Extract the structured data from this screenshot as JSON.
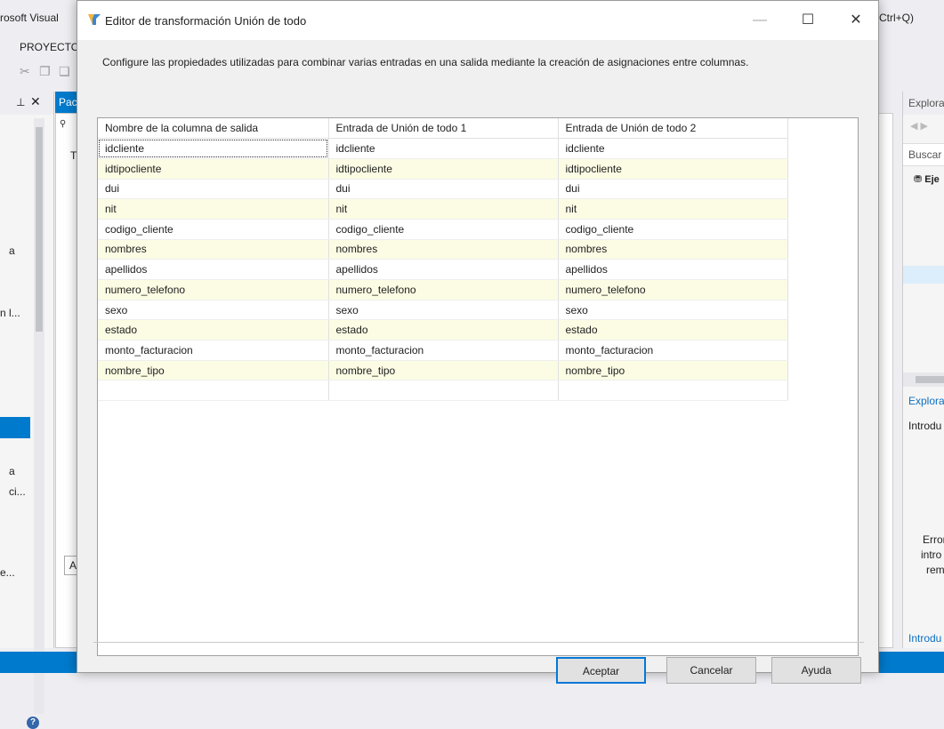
{
  "vs": {
    "title_fragment": "rosoft Visual",
    "search_hint": "(Ctrl+Q)",
    "menu_fragment": "PROYECTO",
    "doc_tab": "Pac",
    "doc_sub": "T",
    "lower_tab": "A",
    "left_labels": [
      "a",
      "n l...",
      "a",
      "ci...",
      "e..."
    ],
    "right": {
      "header": "Explora",
      "search": "Buscar",
      "tree_bold": "Eje",
      "explorer2": "Explora",
      "intro": "Introdu",
      "err_lines": [
        "Error",
        "intro",
        "rem"
      ],
      "intro_link": "Introdu"
    }
  },
  "dialog": {
    "title": "Editor de transformación Unión de todo",
    "description": "Configure las propiedades utilizadas para combinar varias entradas en una salida mediante la creación de asignaciones entre columnas.",
    "columns": [
      "Nombre de la columna de salida",
      "Entrada de Unión de todo 1",
      "Entrada de Unión de todo 2"
    ],
    "rows": [
      [
        "idcliente",
        "idcliente",
        "idcliente"
      ],
      [
        "idtipocliente",
        "idtipocliente",
        "idtipocliente"
      ],
      [
        "dui",
        "dui",
        "dui"
      ],
      [
        "nit",
        "nit",
        "nit"
      ],
      [
        "codigo_cliente",
        "codigo_cliente",
        "codigo_cliente"
      ],
      [
        "nombres",
        "nombres",
        "nombres"
      ],
      [
        "apellidos",
        "apellidos",
        "apellidos"
      ],
      [
        "numero_telefono",
        "numero_telefono",
        "numero_telefono"
      ],
      [
        "sexo",
        "sexo",
        "sexo"
      ],
      [
        "estado",
        "estado",
        "estado"
      ],
      [
        "monto_facturacion",
        "monto_facturacion",
        "monto_facturacion"
      ],
      [
        "nombre_tipo",
        "nombre_tipo",
        "nombre_tipo"
      ]
    ],
    "buttons": {
      "ok": "Aceptar",
      "cancel": "Cancelar",
      "help": "Ayuda"
    }
  },
  "colors": {
    "accent": "#007acc",
    "row_alt": "#fcfce4",
    "ok_border": "#0078d7"
  }
}
